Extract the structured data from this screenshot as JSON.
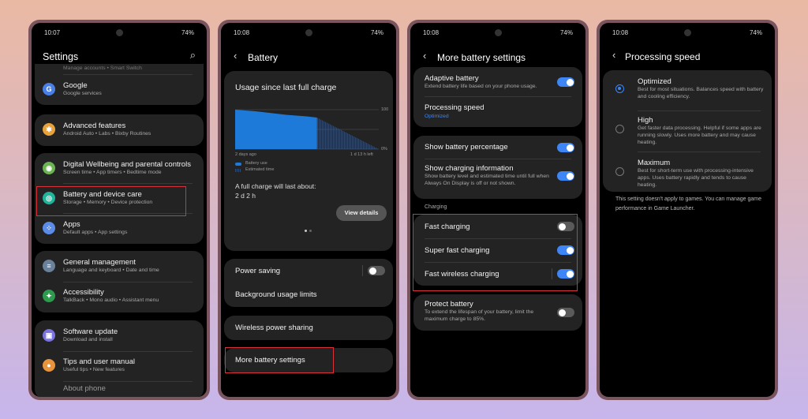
{
  "status": [
    {
      "time": "10:07",
      "battery": "74%"
    },
    {
      "time": "10:08",
      "battery": "74%"
    },
    {
      "time": "10:08",
      "battery": "74%"
    },
    {
      "time": "10:08",
      "battery": "74%"
    }
  ],
  "settings": {
    "title": "Settings",
    "partial": "Manage accounts  •  Smart Switch",
    "items": [
      {
        "label": "Google",
        "sub": "Google services",
        "icon": "google-icon",
        "color": "#4a7fe8",
        "glyph": "G"
      },
      {
        "label": "Advanced features",
        "sub": "Android Auto  •  Labs  •  Bixby Routines",
        "icon": "gear-plus-icon",
        "color": "#e8a23c",
        "glyph": "✱"
      },
      {
        "label": "Digital Wellbeing and parental controls",
        "sub": "Screen time  •  App timers  •  Bedtime mode",
        "icon": "wellbeing-icon",
        "color": "#6cb452",
        "glyph": "◉"
      },
      {
        "label": "Battery and device care",
        "sub": "Storage  •  Memory  •  Device protection",
        "icon": "device-care-icon",
        "color": "#1fb59a",
        "glyph": "◎"
      },
      {
        "label": "Apps",
        "sub": "Default apps  •  App settings",
        "icon": "apps-icon",
        "color": "#5b8de8",
        "glyph": "⁘"
      },
      {
        "label": "General management",
        "sub": "Language and keyboard  •  Date and time",
        "icon": "sliders-icon",
        "color": "#6b8199",
        "glyph": "≡"
      },
      {
        "label": "Accessibility",
        "sub": "TalkBack  •  Mono audio  •  Assistant menu",
        "icon": "accessibility-icon",
        "color": "#2e9a4e",
        "glyph": "✦"
      },
      {
        "label": "Software update",
        "sub": "Download and install",
        "icon": "software-update-icon",
        "color": "#7b74e0",
        "glyph": "▣"
      },
      {
        "label": "Tips and user manual",
        "sub": "Useful tips  •  New features",
        "icon": "tips-icon",
        "color": "#e8943c",
        "glyph": "●"
      }
    ],
    "partial_bottom": "About phone"
  },
  "battery": {
    "title": "Battery",
    "card_title": "Usage since last full charge",
    "chart": {
      "y_top": "100",
      "y_bottom": "0%",
      "x_start": "2 days ago",
      "x_end": "1 d 13 h left",
      "used": [
        100,
        98,
        96,
        93,
        90,
        87,
        85,
        83,
        80
      ],
      "estimated_from": 80,
      "legend": [
        "Battery use",
        "Estimated time"
      ],
      "colors": {
        "used": "#1e7ad8",
        "estimated": "#2f4b73"
      }
    },
    "full_charge_label": "A full charge will last about:",
    "full_charge_value": "2 d 2 h",
    "view_details": "View details",
    "power_saving": "Power saving",
    "power_saving_on": false,
    "background_limits": "Background usage limits",
    "wireless_sharing": "Wireless power sharing",
    "more_settings": "More battery settings"
  },
  "more": {
    "title": "More battery settings",
    "adaptive": {
      "label": "Adaptive battery",
      "sub": "Extend battery life based on your phone usage.",
      "on": true
    },
    "processing": {
      "label": "Processing speed",
      "value": "Optimized"
    },
    "show_pct": {
      "label": "Show battery percentage",
      "on": true
    },
    "show_info": {
      "label": "Show charging information",
      "sub": "Show battery level and estimated time until full when Always On Display is off or not shown.",
      "on": true
    },
    "charging_header": "Charging",
    "charging": [
      {
        "label": "Fast charging",
        "on": false
      },
      {
        "label": "Super fast charging",
        "on": true
      },
      {
        "label": "Fast wireless charging",
        "on": true
      }
    ],
    "protect": {
      "label": "Protect battery",
      "sub": "To extend the lifespan of your battery, limit the maximum charge to 85%.",
      "on": false
    }
  },
  "speed": {
    "title": "Processing speed",
    "selected": 0,
    "options": [
      {
        "label": "Optimized",
        "sub": "Best for most situations. Balances speed with battery and cooling efficiency."
      },
      {
        "label": "High",
        "sub": "Get faster data processing. Helpful if some apps are running slowly. Uses more battery and may cause heating."
      },
      {
        "label": "Maximum",
        "sub": "Best for short-term use with processing-intensive apps. Uses battery rapidly and tends to cause heating."
      }
    ],
    "footer": "This setting doesn't apply to games. You can manage game performance in Game Launcher."
  },
  "accent": "#3e86f5",
  "highlight": "#d8323a"
}
